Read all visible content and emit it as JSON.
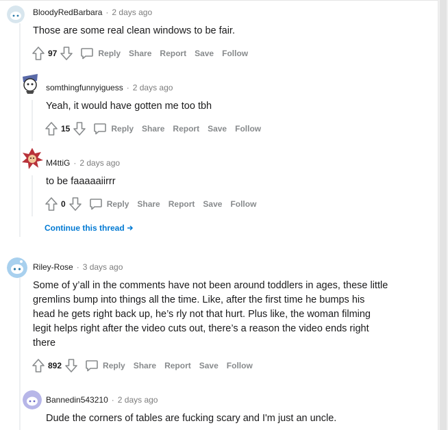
{
  "comments": [
    {
      "author": "BloodyRedBarbara",
      "time": "2 days ago",
      "text": [
        "Those are some real clean windows to be fair."
      ],
      "score": "97"
    },
    {
      "author": "somthingfunnyiguess",
      "time": "2 days ago",
      "text": [
        "Yeah, it would have gotten me too tbh"
      ],
      "score": "15"
    },
    {
      "author": "M4ttiG",
      "time": "2 days ago",
      "text": [
        "to be faaaaaiirrr"
      ],
      "score": "0"
    },
    {
      "author": "Riley-Rose",
      "time": "3 days ago",
      "text": [
        "Some of y’all in the comments have not been around toddlers in ages, these little",
        "gremlins bump into things all the time. Like, after the first time he bumps his",
        "head he gets right back up, he’s rly not that hurt. Plus like, the woman filming",
        "legit helps right after the video cuts out, there’s a reason the video ends right",
        "there"
      ],
      "score": "892"
    },
    {
      "author": "Bannedin543210",
      "time": "2 days ago",
      "text": [
        "Dude the corners of tables are fucking scary and I'm just an uncle."
      ],
      "score": ""
    }
  ],
  "actions": {
    "reply": "Reply",
    "share": "Share",
    "report": "Report",
    "save": "Save",
    "follow": "Follow"
  },
  "continue_thread": "Continue this thread",
  "separator": "·",
  "colors": {
    "link": "#0079d3",
    "action_gray": "#878a8c",
    "meta_gray": "#7c7c7c",
    "thread_line": "#edeff1"
  },
  "icons": [
    "upvote-icon",
    "downvote-icon",
    "comment-bubble-icon",
    "arrow-right-icon",
    "avatar-icon"
  ]
}
